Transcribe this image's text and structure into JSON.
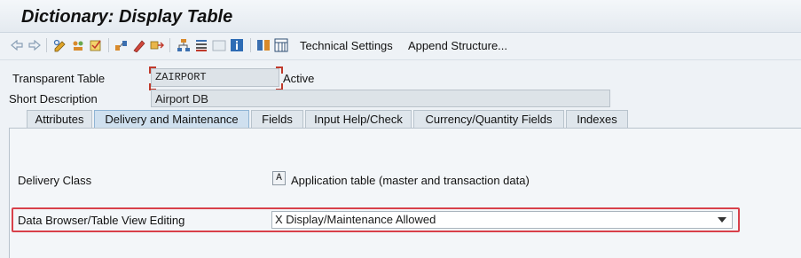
{
  "window": {
    "title": "Dictionary: Display Table"
  },
  "toolbar": {
    "icons": [
      "back-icon",
      "forward-icon",
      "other-object-icon",
      "display-change-icon",
      "activate-icon",
      "where-used-icon",
      "object-list-icon",
      "navigation-icon",
      "hierarchy-icon",
      "info-icon",
      "graphic-icon",
      "contents-icon"
    ],
    "technical_settings_label": "Technical Settings",
    "append_structure_label": "Append Structure..."
  },
  "header": {
    "transparent_table_label": "Transparent Table",
    "table_name": "ZAIRPORT",
    "status": "Active",
    "short_description_label": "Short Description",
    "short_description_value": "Airport DB"
  },
  "tabs": [
    {
      "label": "Attributes",
      "active": false
    },
    {
      "label": "Delivery and Maintenance",
      "active": true
    },
    {
      "label": "Fields",
      "active": false
    },
    {
      "label": "Input Help/Check",
      "active": false
    },
    {
      "label": "Currency/Quantity Fields",
      "active": false
    },
    {
      "label": "Indexes",
      "active": false
    }
  ],
  "delivery": {
    "delivery_class_label": "Delivery Class",
    "delivery_class_value": "A",
    "delivery_class_text": "Application table (master and transaction data)",
    "browser_label": "Data Browser/Table View Editing",
    "browser_value": "X Display/Maintenance Allowed"
  },
  "colors": {
    "highlight": "#d8404a",
    "active_tab": "#cfe0ef"
  }
}
